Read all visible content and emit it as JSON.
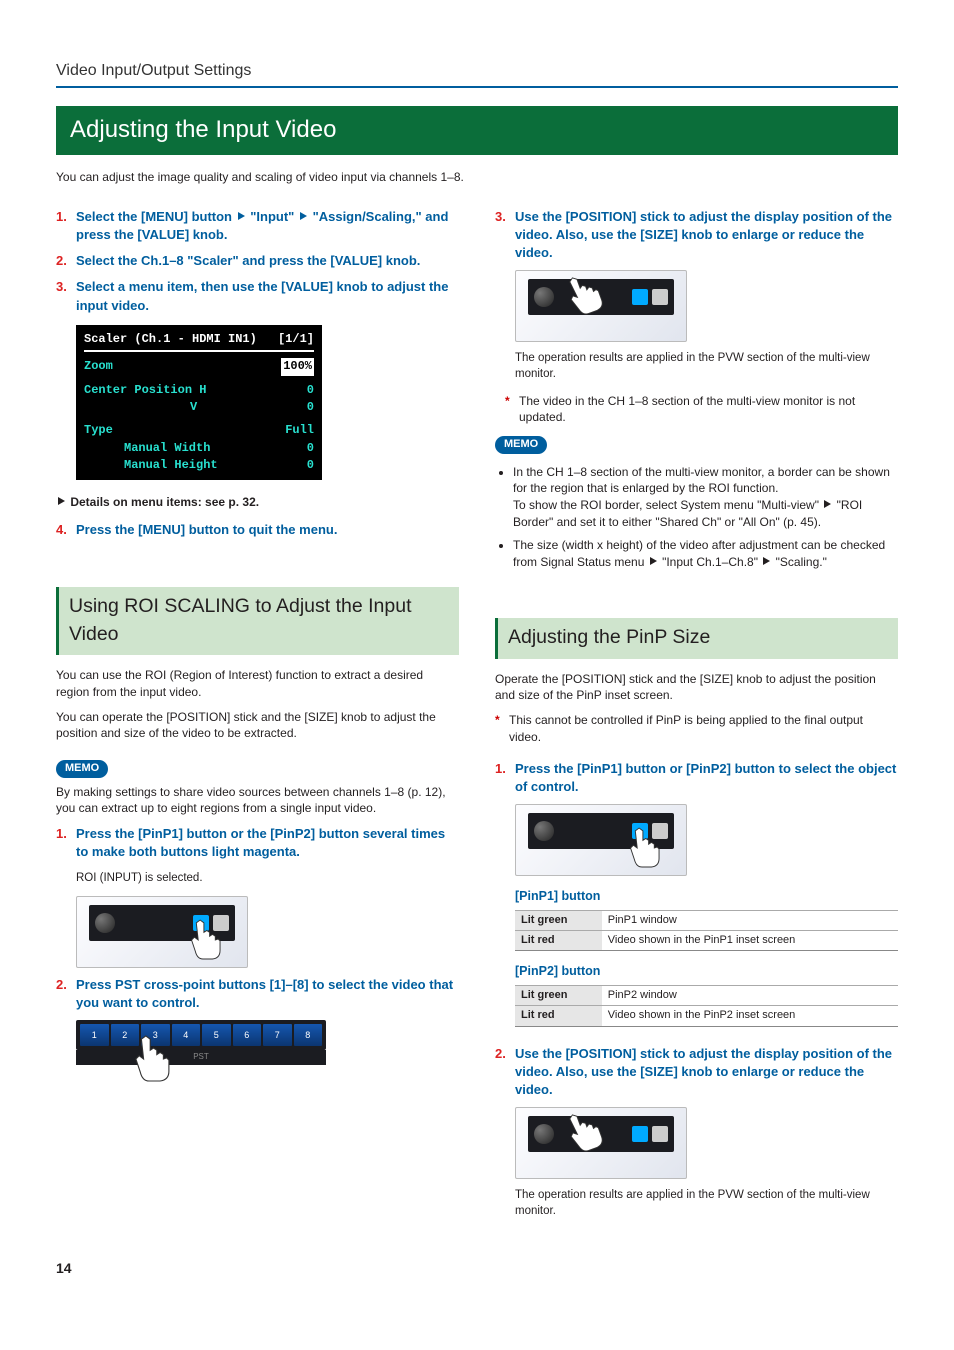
{
  "pretitle": "Video Input/Output Settings",
  "h1": "Adjusting the Input Video",
  "intro": "You can adjust the image quality and scaling of video input via channels 1–8.",
  "left": {
    "step1": "Select the [MENU] button ",
    "step1b": "\"Input\" ",
    "step1c": "\"Assign/Scaling,\" and press the [VALUE] knob.",
    "step2": "Select the Ch.1–8 \"Scaler\" and press the [VALUE] knob.",
    "step3": "Select a menu item, then use the [VALUE] knob to adjust the input video.",
    "menu": {
      "title": "Scaler (Ch.1 - HDMI IN1)",
      "page": "[1/1]",
      "zoom_l": "Zoom",
      "zoom_v": "100%",
      "cp_l": "Center Position H",
      "cp_v1": "0",
      "cp_l2": "V",
      "cp_v2": "0",
      "type_l": "Type",
      "type_v": "Full",
      "mw_l": "Manual Width",
      "mw_v": "0",
      "mh_l": "Manual Height",
      "mh_v": "0"
    },
    "details": "Details on menu items: see p. 32.",
    "step4": "Press the [MENU] button to quit the menu."
  },
  "roi": {
    "title": "Using ROI SCALING to Adjust the Input Video",
    "p1": "You can use the ROI (Region of Interest) function to extract a desired region from the input video.",
    "p2": "You can operate the [POSITION] stick and the [SIZE] knob to adjust the position and size of the video to be extracted.",
    "memo": "By making settings to share video sources between channels 1–8 (p. 12), you can extract up to eight regions from a single input video.",
    "step1": "Press the [PinP1] button or the [PinP2] button several times to make both buttons light magenta.",
    "step1_sub": "ROI (INPUT) is selected.",
    "step2": "Press PST cross-point buttons [1]–[8] to select the video that you want to control.",
    "pst_nums": [
      "1",
      "2",
      "3",
      "4",
      "5",
      "6",
      "7",
      "8"
    ],
    "pst_label": "PST"
  },
  "right": {
    "step3": "Use the [POSITION] stick to adjust the display position of the video. Also, use the [SIZE] knob to enlarge or reduce the video.",
    "res1": "The operation results are applied in the PVW section of the multi-view monitor.",
    "star1": "The video in the CH 1–8 section of the multi-view monitor is not updated.",
    "memo1": "In the CH 1–8 section of the multi-view monitor, a border can be shown for the region that is enlarged by the ROI function.",
    "memo1b_a": "To show the ROI border, select System menu \"Multi-view\" ",
    "memo1b_b": " \"ROI Border\" and set it to either \"Shared Ch\" or \"All On\" (p. 45).",
    "memo2_a": "The size (width x height) of the video after adjustment can be checked from Signal Status menu ",
    "memo2_b": " \"Input Ch.1–Ch.8\" ",
    "memo2_c": " \"Scaling.\""
  },
  "pinp": {
    "title": "Adjusting the PinP Size",
    "p1": "Operate the [POSITION] stick and the [SIZE] knob to adjust the position and size of the PinP inset screen.",
    "star": "This cannot be controlled if PinP is being applied to the final output video.",
    "step1": "Press the [PinP1] button or [PinP2] button to select the object of control.",
    "t1_title": "[PinP1] button",
    "t1_r1a": "Lit green",
    "t1_r1b": "PinP1 window",
    "t1_r2a": "Lit red",
    "t1_r2b": "Video shown in the PinP1 inset screen",
    "t2_title": "[PinP2] button",
    "t2_r1a": "Lit green",
    "t2_r1b": "PinP2 window",
    "t2_r2a": "Lit red",
    "t2_r2b": "Video shown in the PinP2 inset screen",
    "step2": "Use the [POSITION] stick to adjust the display position of the video. Also, use the [SIZE] knob to enlarge or reduce the video.",
    "res": "The operation results are applied in the PVW section of the multi-view monitor."
  },
  "memo_label": "MEMO",
  "page_num": "14"
}
